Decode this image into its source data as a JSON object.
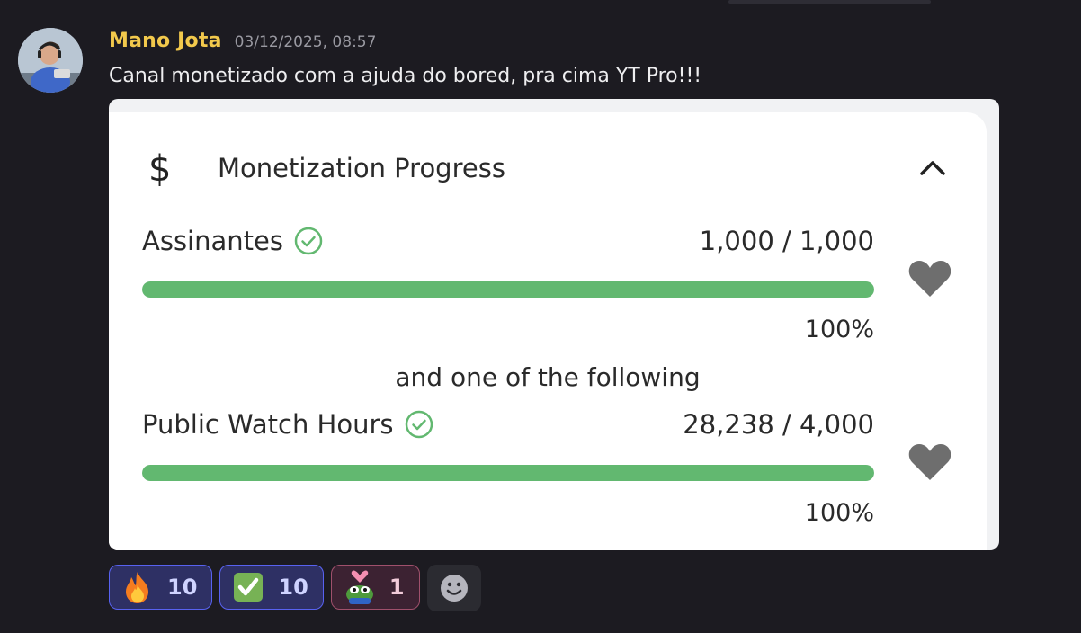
{
  "message": {
    "author": "Mano Jota",
    "timestamp": "03/12/2025, 08:57",
    "text": "Canal monetizado com a ajuda do bored, pra cima YT Pro!!!"
  },
  "embed": {
    "title": "Monetization Progress",
    "separator": "and one of the following",
    "metrics": [
      {
        "label": "Assinantes",
        "value": "1,000 / 1,000",
        "percent_label": "100%",
        "progress": 1.0
      },
      {
        "label": "Public Watch Hours",
        "value": "28,238 / 4,000",
        "percent_label": "100%",
        "progress": 1.0
      }
    ],
    "accent_color": "#62b870"
  },
  "reactions": [
    {
      "emoji": "fire-emoji",
      "count": "10",
      "style": "blue"
    },
    {
      "emoji": "check-mark-button-emoji",
      "count": "10",
      "style": "blue"
    },
    {
      "emoji": "pepe-heart-emoji",
      "count": "1",
      "style": "pink"
    }
  ],
  "colors": {
    "username": "#f2c94c",
    "background": "#1c1b21",
    "progress": "#62b870"
  }
}
